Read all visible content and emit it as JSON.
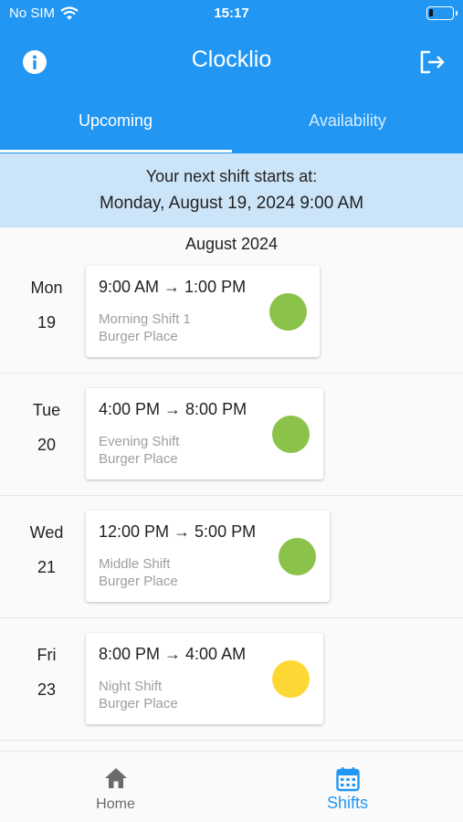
{
  "status_bar": {
    "carrier": "No SIM",
    "time": "15:17"
  },
  "app": {
    "title": "Clocklio"
  },
  "tabs": [
    {
      "label": "Upcoming",
      "active": true
    },
    {
      "label": "Availability",
      "active": false
    }
  ],
  "next_shift": {
    "label": "Your next shift starts at:",
    "value": "Monday, August 19, 2024 9:00 AM"
  },
  "month_header": "August 2024",
  "shifts": [
    {
      "weekday": "Mon",
      "day": "19",
      "time": "9:00 AM → 1:00 PM",
      "name": "Morning Shift 1",
      "place": "Burger Place",
      "status_color": "#8bc34a"
    },
    {
      "weekday": "Tue",
      "day": "20",
      "time": "4:00 PM → 8:00 PM",
      "name": "Evening Shift",
      "place": "Burger Place",
      "status_color": "#8bc34a"
    },
    {
      "weekday": "Wed",
      "day": "21",
      "time": "12:00 PM → 5:00 PM",
      "name": "Middle Shift",
      "place": "Burger Place",
      "status_color": "#8bc34a"
    },
    {
      "weekday": "Fri",
      "day": "23",
      "time": "8:00 PM → 4:00 AM",
      "name": "Night Shift",
      "place": "Burger Place",
      "status_color": "#fdd835"
    }
  ],
  "bottom_nav": [
    {
      "label": "Home",
      "icon": "home-icon",
      "active": false
    },
    {
      "label": "Shifts",
      "icon": "calendar-icon",
      "active": true
    }
  ],
  "colors": {
    "primary": "#2196f3",
    "banner": "#cce4f8",
    "status_green": "#8bc34a",
    "status_yellow": "#fdd835"
  }
}
